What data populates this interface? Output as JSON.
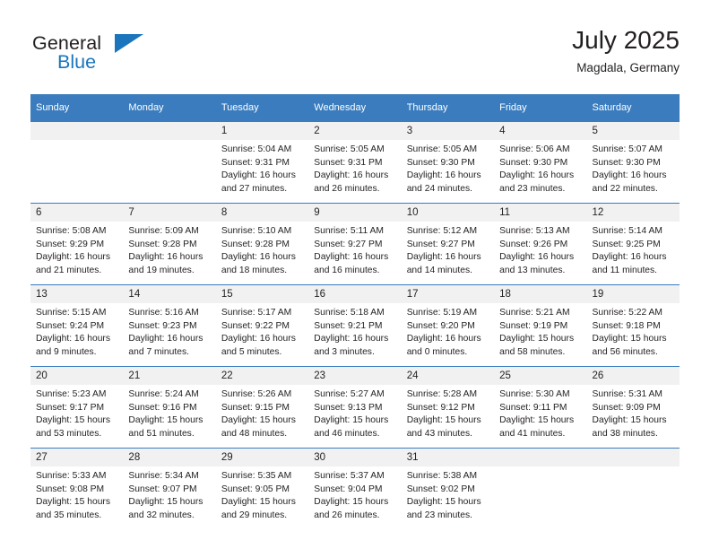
{
  "brand": {
    "name_top": "General",
    "name_bottom": "Blue",
    "triangle_color": "#1b75bc"
  },
  "header": {
    "title": "July 2025",
    "subtitle": "Magdala, Germany"
  },
  "theme": {
    "header_blue": "#3a7cbe",
    "daynum_bg": "#f1f1f1",
    "text": "#231f20"
  },
  "weekday_headers": [
    "Sunday",
    "Monday",
    "Tuesday",
    "Wednesday",
    "Thursday",
    "Friday",
    "Saturday"
  ],
  "weeks": [
    [
      {
        "day": "",
        "sunrise": "",
        "sunset": "",
        "daylight1": "",
        "daylight2": ""
      },
      {
        "day": "",
        "sunrise": "",
        "sunset": "",
        "daylight1": "",
        "daylight2": ""
      },
      {
        "day": "1",
        "sunrise": "Sunrise: 5:04 AM",
        "sunset": "Sunset: 9:31 PM",
        "daylight1": "Daylight: 16 hours",
        "daylight2": "and 27 minutes."
      },
      {
        "day": "2",
        "sunrise": "Sunrise: 5:05 AM",
        "sunset": "Sunset: 9:31 PM",
        "daylight1": "Daylight: 16 hours",
        "daylight2": "and 26 minutes."
      },
      {
        "day": "3",
        "sunrise": "Sunrise: 5:05 AM",
        "sunset": "Sunset: 9:30 PM",
        "daylight1": "Daylight: 16 hours",
        "daylight2": "and 24 minutes."
      },
      {
        "day": "4",
        "sunrise": "Sunrise: 5:06 AM",
        "sunset": "Sunset: 9:30 PM",
        "daylight1": "Daylight: 16 hours",
        "daylight2": "and 23 minutes."
      },
      {
        "day": "5",
        "sunrise": "Sunrise: 5:07 AM",
        "sunset": "Sunset: 9:30 PM",
        "daylight1": "Daylight: 16 hours",
        "daylight2": "and 22 minutes."
      }
    ],
    [
      {
        "day": "6",
        "sunrise": "Sunrise: 5:08 AM",
        "sunset": "Sunset: 9:29 PM",
        "daylight1": "Daylight: 16 hours",
        "daylight2": "and 21 minutes."
      },
      {
        "day": "7",
        "sunrise": "Sunrise: 5:09 AM",
        "sunset": "Sunset: 9:28 PM",
        "daylight1": "Daylight: 16 hours",
        "daylight2": "and 19 minutes."
      },
      {
        "day": "8",
        "sunrise": "Sunrise: 5:10 AM",
        "sunset": "Sunset: 9:28 PM",
        "daylight1": "Daylight: 16 hours",
        "daylight2": "and 18 minutes."
      },
      {
        "day": "9",
        "sunrise": "Sunrise: 5:11 AM",
        "sunset": "Sunset: 9:27 PM",
        "daylight1": "Daylight: 16 hours",
        "daylight2": "and 16 minutes."
      },
      {
        "day": "10",
        "sunrise": "Sunrise: 5:12 AM",
        "sunset": "Sunset: 9:27 PM",
        "daylight1": "Daylight: 16 hours",
        "daylight2": "and 14 minutes."
      },
      {
        "day": "11",
        "sunrise": "Sunrise: 5:13 AM",
        "sunset": "Sunset: 9:26 PM",
        "daylight1": "Daylight: 16 hours",
        "daylight2": "and 13 minutes."
      },
      {
        "day": "12",
        "sunrise": "Sunrise: 5:14 AM",
        "sunset": "Sunset: 9:25 PM",
        "daylight1": "Daylight: 16 hours",
        "daylight2": "and 11 minutes."
      }
    ],
    [
      {
        "day": "13",
        "sunrise": "Sunrise: 5:15 AM",
        "sunset": "Sunset: 9:24 PM",
        "daylight1": "Daylight: 16 hours",
        "daylight2": "and 9 minutes."
      },
      {
        "day": "14",
        "sunrise": "Sunrise: 5:16 AM",
        "sunset": "Sunset: 9:23 PM",
        "daylight1": "Daylight: 16 hours",
        "daylight2": "and 7 minutes."
      },
      {
        "day": "15",
        "sunrise": "Sunrise: 5:17 AM",
        "sunset": "Sunset: 9:22 PM",
        "daylight1": "Daylight: 16 hours",
        "daylight2": "and 5 minutes."
      },
      {
        "day": "16",
        "sunrise": "Sunrise: 5:18 AM",
        "sunset": "Sunset: 9:21 PM",
        "daylight1": "Daylight: 16 hours",
        "daylight2": "and 3 minutes."
      },
      {
        "day": "17",
        "sunrise": "Sunrise: 5:19 AM",
        "sunset": "Sunset: 9:20 PM",
        "daylight1": "Daylight: 16 hours",
        "daylight2": "and 0 minutes."
      },
      {
        "day": "18",
        "sunrise": "Sunrise: 5:21 AM",
        "sunset": "Sunset: 9:19 PM",
        "daylight1": "Daylight: 15 hours",
        "daylight2": "and 58 minutes."
      },
      {
        "day": "19",
        "sunrise": "Sunrise: 5:22 AM",
        "sunset": "Sunset: 9:18 PM",
        "daylight1": "Daylight: 15 hours",
        "daylight2": "and 56 minutes."
      }
    ],
    [
      {
        "day": "20",
        "sunrise": "Sunrise: 5:23 AM",
        "sunset": "Sunset: 9:17 PM",
        "daylight1": "Daylight: 15 hours",
        "daylight2": "and 53 minutes."
      },
      {
        "day": "21",
        "sunrise": "Sunrise: 5:24 AM",
        "sunset": "Sunset: 9:16 PM",
        "daylight1": "Daylight: 15 hours",
        "daylight2": "and 51 minutes."
      },
      {
        "day": "22",
        "sunrise": "Sunrise: 5:26 AM",
        "sunset": "Sunset: 9:15 PM",
        "daylight1": "Daylight: 15 hours",
        "daylight2": "and 48 minutes."
      },
      {
        "day": "23",
        "sunrise": "Sunrise: 5:27 AM",
        "sunset": "Sunset: 9:13 PM",
        "daylight1": "Daylight: 15 hours",
        "daylight2": "and 46 minutes."
      },
      {
        "day": "24",
        "sunrise": "Sunrise: 5:28 AM",
        "sunset": "Sunset: 9:12 PM",
        "daylight1": "Daylight: 15 hours",
        "daylight2": "and 43 minutes."
      },
      {
        "day": "25",
        "sunrise": "Sunrise: 5:30 AM",
        "sunset": "Sunset: 9:11 PM",
        "daylight1": "Daylight: 15 hours",
        "daylight2": "and 41 minutes."
      },
      {
        "day": "26",
        "sunrise": "Sunrise: 5:31 AM",
        "sunset": "Sunset: 9:09 PM",
        "daylight1": "Daylight: 15 hours",
        "daylight2": "and 38 minutes."
      }
    ],
    [
      {
        "day": "27",
        "sunrise": "Sunrise: 5:33 AM",
        "sunset": "Sunset: 9:08 PM",
        "daylight1": "Daylight: 15 hours",
        "daylight2": "and 35 minutes."
      },
      {
        "day": "28",
        "sunrise": "Sunrise: 5:34 AM",
        "sunset": "Sunset: 9:07 PM",
        "daylight1": "Daylight: 15 hours",
        "daylight2": "and 32 minutes."
      },
      {
        "day": "29",
        "sunrise": "Sunrise: 5:35 AM",
        "sunset": "Sunset: 9:05 PM",
        "daylight1": "Daylight: 15 hours",
        "daylight2": "and 29 minutes."
      },
      {
        "day": "30",
        "sunrise": "Sunrise: 5:37 AM",
        "sunset": "Sunset: 9:04 PM",
        "daylight1": "Daylight: 15 hours",
        "daylight2": "and 26 minutes."
      },
      {
        "day": "31",
        "sunrise": "Sunrise: 5:38 AM",
        "sunset": "Sunset: 9:02 PM",
        "daylight1": "Daylight: 15 hours",
        "daylight2": "and 23 minutes."
      },
      {
        "day": "",
        "sunrise": "",
        "sunset": "",
        "daylight1": "",
        "daylight2": ""
      },
      {
        "day": "",
        "sunrise": "",
        "sunset": "",
        "daylight1": "",
        "daylight2": ""
      }
    ]
  ]
}
